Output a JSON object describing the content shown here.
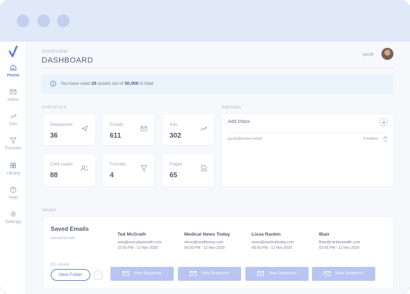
{
  "window": {
    "controls": [
      "close",
      "minimize",
      "maximize"
    ]
  },
  "sidebar": {
    "items": [
      {
        "label": "Home",
        "icon": "home-icon",
        "active": true
      },
      {
        "label": "Inbox",
        "icon": "mail-icon",
        "active": false
      },
      {
        "label": "Ads",
        "icon": "trend-icon",
        "active": false
      },
      {
        "label": "Funnels",
        "icon": "filter-icon",
        "active": false
      },
      {
        "label": "Library",
        "icon": "grid-icon",
        "active": false
      },
      {
        "label": "Help",
        "icon": "help-icon",
        "active": false
      },
      {
        "label": "Settings",
        "icon": "gear-icon",
        "active": false
      }
    ]
  },
  "header": {
    "overline": "OVERVIEW",
    "title": "DASHBOARD",
    "user_name": "jacob"
  },
  "alert": {
    "prefix": "You have used",
    "used": "26",
    "middle": "assets out of",
    "total": "50,000",
    "suffix": "in total."
  },
  "statistics": {
    "section_label": "STATISTICS",
    "cards": [
      {
        "label": "Sequences",
        "value": "36",
        "icon": "send-icon"
      },
      {
        "label": "Emails",
        "value": "611",
        "icon": "mail-icon"
      },
      {
        "label": "Ads",
        "value": "302",
        "icon": "trend-icon"
      },
      {
        "label": "Cold Leads",
        "value": "88",
        "icon": "users-icon"
      },
      {
        "label": "Funnels",
        "value": "4",
        "icon": "filter-icon"
      },
      {
        "label": "Pages",
        "value": "65",
        "icon": "document-icon"
      }
    ]
  },
  "inboxes": {
    "section_label": "INBOXES",
    "title": "Add Inbox",
    "rows": [
      {
        "email": "jacob@yoovo.email",
        "folders": "4 folders"
      }
    ]
  },
  "saved": {
    "section_label": "SAVED",
    "title": "Saved Emails",
    "subtitle": "Saved Emails",
    "count": "611 emails",
    "view_folder": "View Folder",
    "more": "···",
    "emails": [
      {
        "name": "Ted McGrath",
        "email": "new@everydayhealth.com",
        "date": "10:50 PM - 12 Nov 2020",
        "button": "View Sequence"
      },
      {
        "name": "Medical News Today",
        "email": "steve@nerdfitness.com",
        "date": "09:20 PM - 12 Nov 2020",
        "button": "View Sequence"
      },
      {
        "name": "Lissa Rankin",
        "email": "news@medicaltoday.com",
        "date": "08:05 PM - 12 Nov 2020",
        "button": "View Sequence"
      },
      {
        "name": "Blair",
        "email": "Blair@mlnfitzwealth.com",
        "date": "02:05 PM - 11 Nov 2020",
        "button": "View Sequence"
      }
    ]
  },
  "colors": {
    "accent": "#4b63b8",
    "button_fill": "#a9b9ee",
    "titlebar": "#d9e4f7",
    "alert_bg": "#e6f0fb"
  }
}
